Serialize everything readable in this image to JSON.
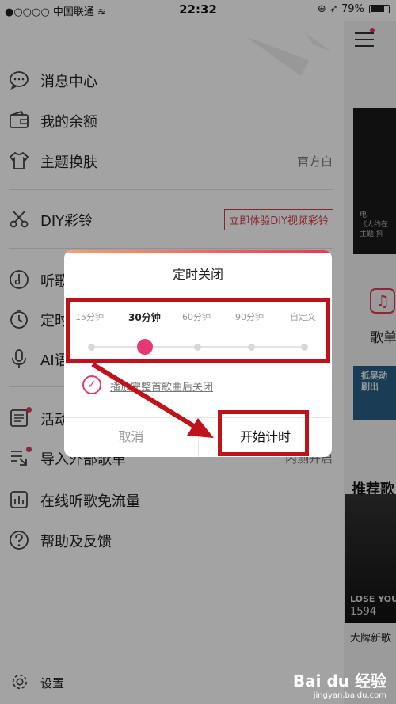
{
  "status_bar": {
    "carrier": "●○○○○ 中国联通",
    "wifi_icon": "wifi-icon",
    "time": "22:32",
    "battery_text": "79%",
    "battery_level": 0.79
  },
  "menu": [
    {
      "label": "消息中心",
      "icon": "message-icon"
    },
    {
      "label": "我的余额",
      "icon": "wallet-icon"
    },
    {
      "label": "主题换肤",
      "icon": "shirt-icon",
      "value": "官方白"
    },
    {
      "label": "DIY彩铃",
      "icon": "diy-icon",
      "tag": "立即体验DIY视频彩铃"
    },
    {
      "label": "听歌",
      "icon": "music-disc-icon"
    },
    {
      "label": "定时",
      "icon": "timer-icon"
    },
    {
      "label": "AI语",
      "icon": "microphone-icon"
    },
    {
      "label": "活动",
      "icon": "activity-icon"
    },
    {
      "label": "导入外部歌单",
      "icon": "import-icon",
      "value": "内测开启"
    },
    {
      "label": "在线听歌免流量",
      "icon": "stats-icon"
    },
    {
      "label": "帮助及反馈",
      "icon": "help-icon"
    }
  ],
  "settings_label": "设置",
  "right_pane": {
    "cover1_text": "电\n《大约在\n主题 抖",
    "gedan": "歌单",
    "cover2_text": "抵吴动\n刷出",
    "tuijian": "推荐歌",
    "cover3_text1": "LOSE YOU",
    "cover3_text2": "1594",
    "dapai": "大牌新歌"
  },
  "dialog": {
    "title": "定时关闭",
    "options": [
      "15分钟",
      "30分钟",
      "60分钟",
      "90分钟",
      "自定义"
    ],
    "selected_index": 1,
    "checkbox_label": "播放完整首歌曲后关闭",
    "checkbox_checked": true,
    "cancel_label": "取消",
    "start_label": "开始计时"
  },
  "watermark": {
    "brand": "Bai du 经验",
    "url": "jingyan.baidu.com"
  },
  "colors": {
    "accent": "#e53974",
    "annotation": "#c0121a"
  }
}
